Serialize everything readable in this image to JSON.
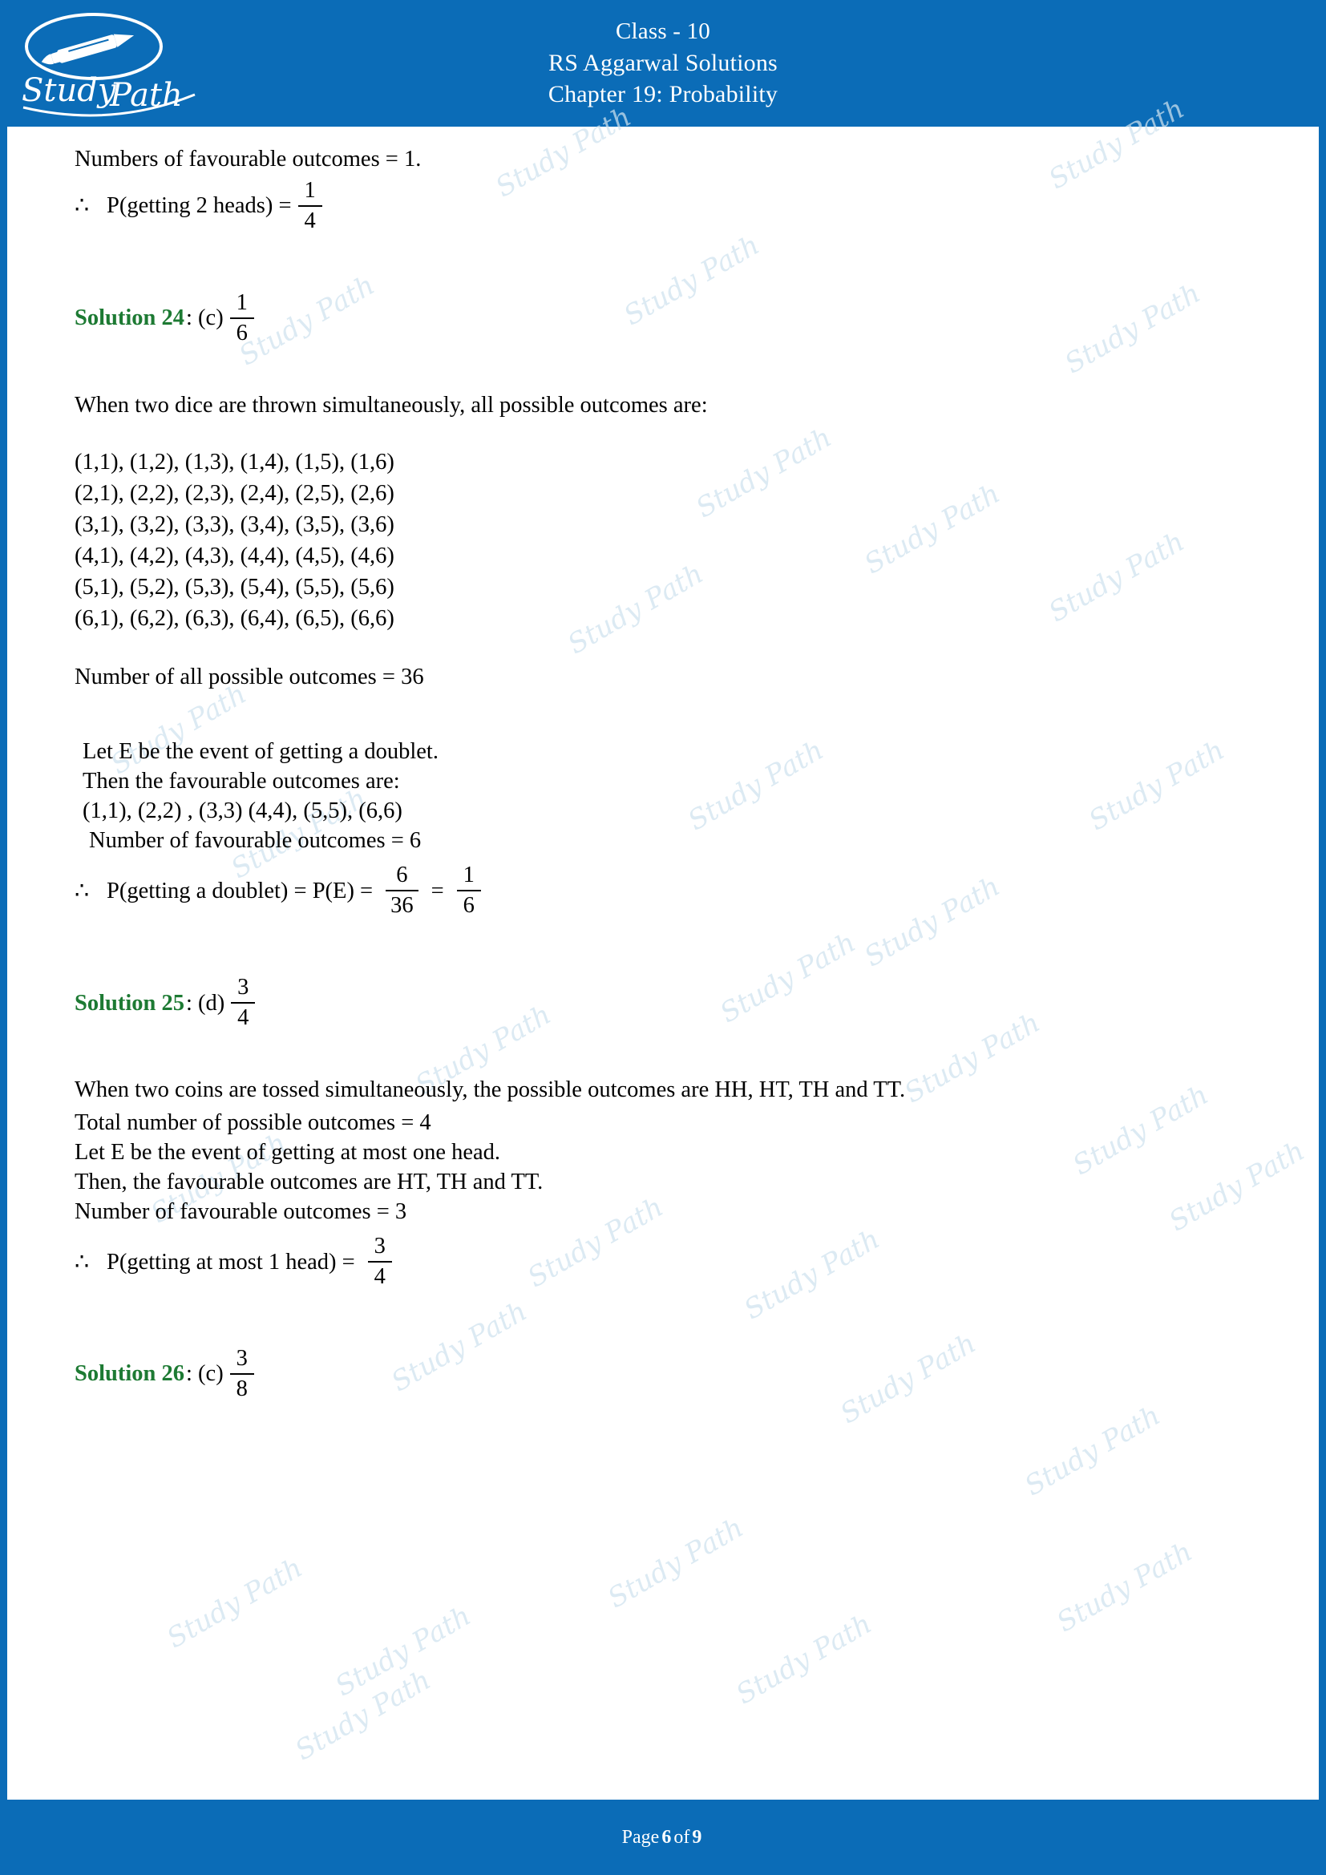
{
  "header": {
    "logo_text": "Study Path",
    "line1": "Class - 10",
    "line2": "RS Aggarwal Solutions",
    "line3": "Chapter 19: Probability"
  },
  "footer": {
    "prefix": "Page",
    "page": "6",
    "middle": "of",
    "total": "9"
  },
  "watermark": {
    "text": "Study Path"
  },
  "content": {
    "l1": "Numbers of favourable outcomes = 1.",
    "l2_sym": "∴",
    "l2_text": "P(getting 2 heads)  =",
    "l2_num": "1",
    "l2_den": "4",
    "sol24_label": "Solution 24",
    "sol24_colon": ": (c)",
    "sol24_num": "1",
    "sol24_den": "6",
    "l3": "When two dice are thrown simultaneously, all possible outcomes are:",
    "dice_rows": [
      "(1,1), (1,2), (1,3), (1,4), (1,5), (1,6)",
      "(2,1), (2,2), (2,3), (2,4), (2,5), (2,6)",
      "(3,1), (3,2), (3,3), (3,4), (3,5), (3,6)",
      "(4,1), (4,2), (4,3), (4,4), (4,5), (4,6)",
      "(5,1), (5,2), (5,3), (5,4), (5,5), (5,6)",
      "(6,1), (6,2), (6,3), (6,4), (6,5), (6,6)"
    ],
    "l4": "Number of all possible outcomes = 36",
    "l5": "Let E be the event of getting a doublet.",
    "l6": "Then the favourable outcomes are:",
    "l7": "(1,1), (2,2) , (3,3) (4,4), (5,5), (6,6)",
    "l8": "Number of favourable outcomes = 6",
    "l9_sym": "∴",
    "l9_text": "P(getting a doublet)  =  P(E)  =",
    "l9_num1": "6",
    "l9_den1": "36",
    "l9_eq": "=",
    "l9_num2": "1",
    "l9_den2": "6",
    "sol25_label": "Solution 25",
    "sol25_colon": ": (d)",
    "sol25_num": "3",
    "sol25_den": "4",
    "l10": "When two coins are tossed simultaneously, the possible outcomes are HH, HT, TH and TT.",
    "l11": "Total number of possible outcomes = 4",
    "l12": "Let E be the event of getting at most one head.",
    "l13": "Then, the favourable outcomes are HT, TH and TT.",
    "l14": "Number of favourable outcomes = 3",
    "l15_sym": "∴",
    "l15_text": "P(getting at most 1 head)  =",
    "l15_num": "3",
    "l15_den": "4",
    "sol26_label": "Solution 26",
    "sol26_colon": ": (c)",
    "sol26_num": "3",
    "sol26_den": "8"
  }
}
